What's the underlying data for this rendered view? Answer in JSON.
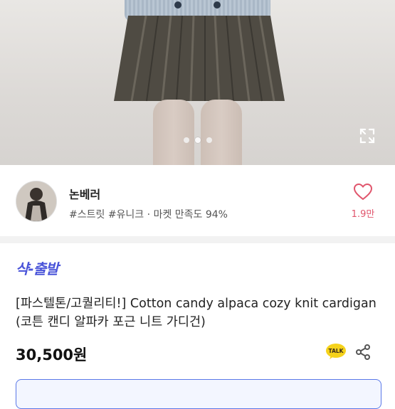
{
  "gallery": {
    "dot_count": 3,
    "active_index": 1,
    "expand_icon": "expand-icon"
  },
  "seller": {
    "name": "논베러",
    "tags": "#스트릿 #유니크",
    "separator": " · ",
    "satisfaction_label": "마켓 만족도 94%",
    "likes": "1.9만",
    "like_icon": "heart-icon",
    "colors": {
      "like": "#e0556c"
    }
  },
  "product": {
    "brand_badge": "샥-출발",
    "title": "[파스텔톤/고퀄리티!] Cotton candy alpaca cozy knit cardigan (코튼 캔디 알파카 포근 니트 가디건)",
    "price": "30,500원",
    "talk_badge": "TALK",
    "colors": {
      "badge": "#4b55d9",
      "accent": "#5a78e8"
    }
  }
}
